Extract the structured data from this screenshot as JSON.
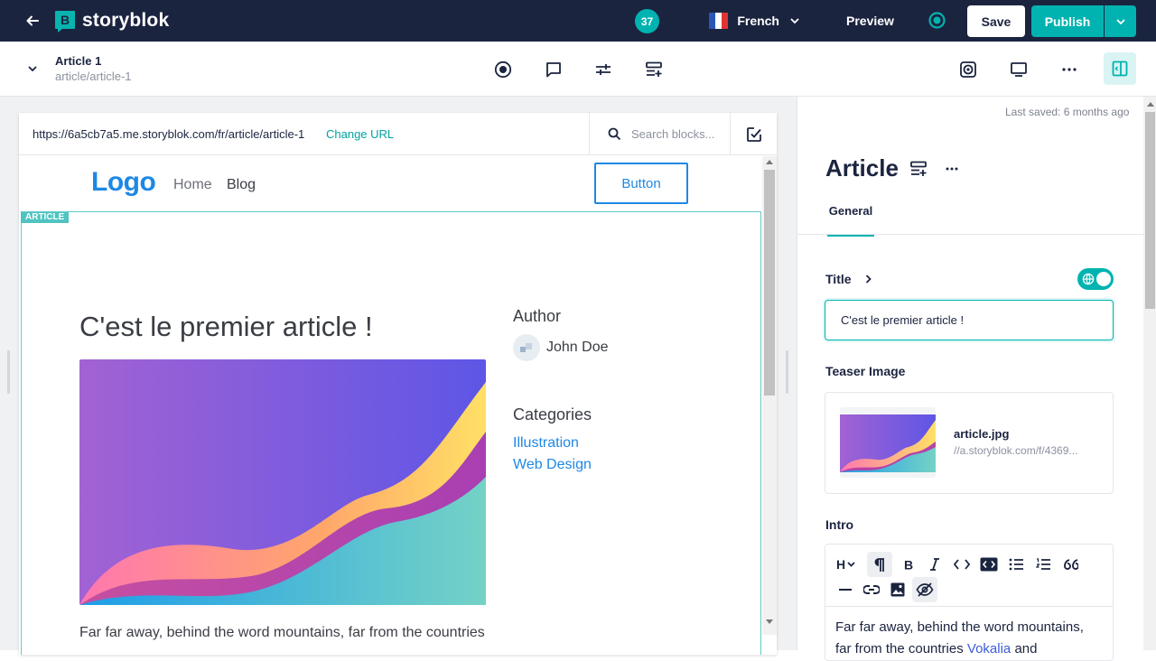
{
  "topbar": {
    "brand": "storyblok",
    "notification_count": "37",
    "language": "French",
    "preview_label": "Preview",
    "save_label": "Save",
    "publish_label": "Publish"
  },
  "story": {
    "name": "Article 1",
    "slug": "article/article-1"
  },
  "preview": {
    "url": "https://6a5cb7a5.me.storyblok.com/fr/article/article-1",
    "change_url_label": "Change URL",
    "search_placeholder": "Search blocks...",
    "site": {
      "logo": "Logo",
      "nav_home": "Home",
      "nav_blog": "Blog",
      "button": "Button",
      "block_tag": "ARTICLE",
      "article_title": "C'est le premier article !",
      "author_heading": "Author",
      "author_name": "John Doe",
      "categories_heading": "Categories",
      "categories": [
        "Illustration",
        "Web Design"
      ],
      "intro_text": "Far far away, behind the word mountains, far from the countries"
    }
  },
  "panel": {
    "last_saved": "Last saved: 6 months ago",
    "component_title": "Article",
    "tab_general": "General",
    "title_label": "Title",
    "title_value": "C'est le premier article !",
    "teaser_label": "Teaser Image",
    "asset_filename": "article.jpg",
    "asset_url": "//a.storyblok.com/f/4369...",
    "intro_label": "Intro",
    "intro_text_line1": "Far far away, behind the word mountains,",
    "intro_text_line2_plain": "far from the countries ",
    "intro_text_line2_link": "Vokalia",
    "intro_text_line2_end": " and"
  },
  "colors": {
    "navy": "#1b243f",
    "teal": "#00b3b0",
    "link_blue": "#1e88e5"
  }
}
